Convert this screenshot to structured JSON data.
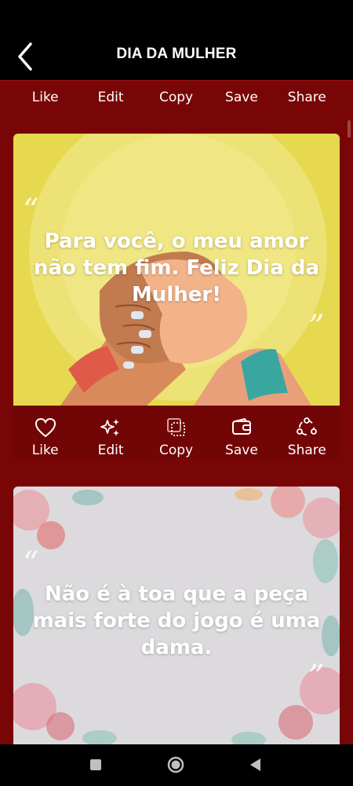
{
  "header": {
    "title": "DIA DA MULHER"
  },
  "top_actions": {
    "like": "Like",
    "edit": "Edit",
    "copy": "Copy",
    "save": "Save",
    "share": "Share"
  },
  "cards": [
    {
      "quote": "Para você, o meu amor não tem fim. Feliz Dia da Mulher!",
      "actions": {
        "like": "Like",
        "edit": "Edit",
        "copy": "Copy",
        "save": "Save",
        "share": "Share"
      }
    },
    {
      "quote": "Não é à toa que a peça mais forte do jogo é uma dama."
    }
  ],
  "colors": {
    "background": "#7a0606",
    "header": "#000000",
    "text": "#ffffff"
  },
  "icons": [
    "back-arrow-icon",
    "heart-icon",
    "sparkle-icon",
    "copy-icon",
    "wallet-icon",
    "share-icon",
    "square-icon",
    "circle-icon",
    "triangle-back-icon"
  ]
}
